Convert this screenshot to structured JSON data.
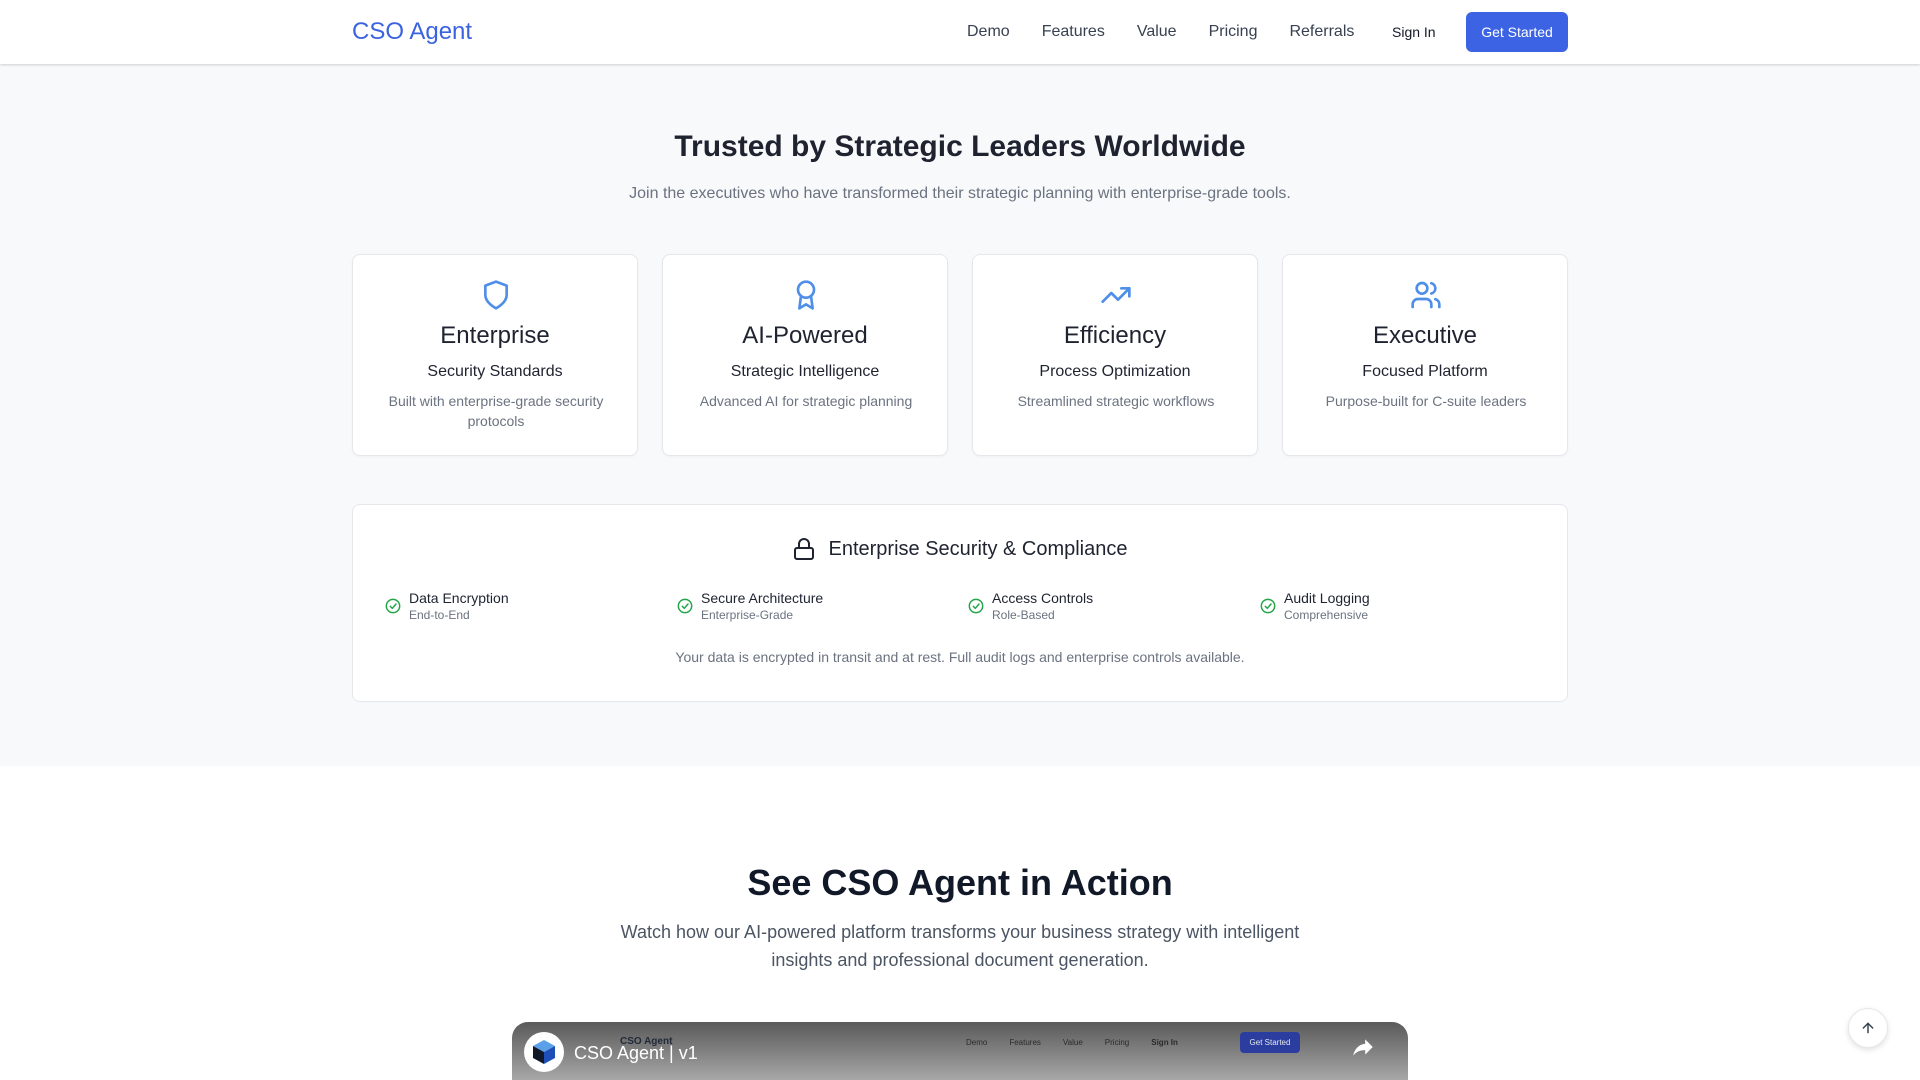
{
  "header": {
    "logo": "CSO Agent",
    "nav": [
      "Demo",
      "Features",
      "Value",
      "Pricing",
      "Referrals"
    ],
    "sign_in": "Sign In",
    "get_started": "Get Started"
  },
  "trusted": {
    "title": "Trusted by Strategic Leaders Worldwide",
    "subtitle": "Join the executives who have transformed their strategic planning with enterprise-grade tools.",
    "cards": [
      {
        "icon": "shield-icon",
        "title": "Enterprise",
        "subtitle": "Security Standards",
        "desc": "Built with enterprise-grade security protocols"
      },
      {
        "icon": "award-icon",
        "title": "AI-Powered",
        "subtitle": "Strategic Intelligence",
        "desc": "Advanced AI for strategic planning"
      },
      {
        "icon": "trending-up-icon",
        "title": "Efficiency",
        "subtitle": "Process Optimization",
        "desc": "Streamlined strategic workflows"
      },
      {
        "icon": "users-icon",
        "title": "Executive",
        "subtitle": "Focused Platform",
        "desc": "Purpose-built for C-suite leaders"
      }
    ]
  },
  "security": {
    "title": "Enterprise Security & Compliance",
    "items": [
      {
        "label": "Data Encryption",
        "sub": "End-to-End"
      },
      {
        "label": "Secure Architecture",
        "sub": "Enterprise-Grade"
      },
      {
        "label": "Access Controls",
        "sub": "Role-Based"
      },
      {
        "label": "Audit Logging",
        "sub": "Comprehensive"
      }
    ],
    "note": "Your data is encrypted in transit and at rest. Full audit logs and enterprise controls available."
  },
  "demo": {
    "title": "See CSO Agent in Action",
    "subtitle": "Watch how our AI-powered platform transforms your business strategy with intelligent insights and professional document generation.",
    "video": {
      "title": "CSO Agent | v1",
      "inner_logo": "CSO Agent",
      "inner_nav": [
        "Demo",
        "Features",
        "Value",
        "Pricing",
        "Sign In"
      ],
      "inner_button": "Get Started"
    }
  },
  "colors": {
    "accent": "#3c63e3",
    "icon_blue": "#4f8fe8",
    "check_green": "#22a447"
  }
}
